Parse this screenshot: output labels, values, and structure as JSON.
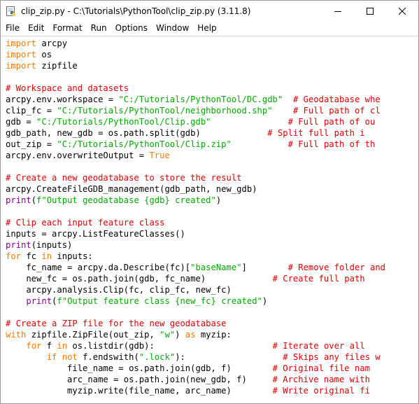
{
  "window": {
    "title": "clip_zip.py - C:\\Tutorials\\PythonTool\\clip_zip.py (3.11.8)",
    "icons": {
      "app": "python-idle-icon",
      "minimize": "minimize-icon",
      "maximize": "maximize-icon",
      "close": "close-icon"
    }
  },
  "menu": [
    "File",
    "Edit",
    "Format",
    "Run",
    "Options",
    "Window",
    "Help"
  ],
  "colors": {
    "keyword": "#ff7700",
    "string": "#00aa00",
    "comment": "#dd0000",
    "builtin": "#900090",
    "default": "#000000"
  },
  "code_lines": [
    [
      [
        "kw",
        "import"
      ],
      [
        "t",
        " arcpy"
      ]
    ],
    [
      [
        "kw",
        "import"
      ],
      [
        "t",
        " os"
      ]
    ],
    [
      [
        "kw",
        "import"
      ],
      [
        "t",
        " zipfile"
      ]
    ],
    [],
    [
      [
        "com",
        "# Workspace and datasets"
      ]
    ],
    [
      [
        "t",
        "arcpy.env.workspace = "
      ],
      [
        "str",
        "\"C:/Tutorials/PythonTool/DC.gdb\""
      ],
      [
        "t",
        "  "
      ],
      [
        "com",
        "# Geodatabase whe"
      ]
    ],
    [
      [
        "t",
        "clip_fc = "
      ],
      [
        "str",
        "\"C:/Tutorials/PythonTool/neighborhood.shp\""
      ],
      [
        "t",
        "    "
      ],
      [
        "com",
        "# Full path of cl"
      ]
    ],
    [
      [
        "t",
        "gdb = "
      ],
      [
        "str",
        "\"C:/Tutorials/PythonTool/Clip.gdb\""
      ],
      [
        "t",
        "               "
      ],
      [
        "com",
        "# Full path of ou"
      ]
    ],
    [
      [
        "t",
        "gdb_path, new_gdb = os.path.split(gdb)"
      ],
      [
        "t",
        "             "
      ],
      [
        "com",
        "# Split full path i"
      ]
    ],
    [
      [
        "t",
        "out_zip = "
      ],
      [
        "str",
        "\"C:/Tutorials/PythonTool/Clip.zip\""
      ],
      [
        "t",
        "           "
      ],
      [
        "com",
        "# Full path of th"
      ]
    ],
    [
      [
        "t",
        "arcpy.env.overwriteOutput = "
      ],
      [
        "kw",
        "True"
      ]
    ],
    [],
    [
      [
        "com",
        "# Create a new geodatabase to store the result"
      ]
    ],
    [
      [
        "t",
        "arcpy.CreateFileGDB_management(gdb_path, new_gdb)"
      ]
    ],
    [
      [
        "bi",
        "print"
      ],
      [
        "t",
        "("
      ],
      [
        "str",
        "f\"Output geodatabase {gdb} created\""
      ],
      [
        "t",
        ")"
      ]
    ],
    [],
    [
      [
        "com",
        "# Clip each input feature class"
      ]
    ],
    [
      [
        "t",
        "inputs = arcpy.ListFeatureClasses()"
      ]
    ],
    [
      [
        "bi",
        "print"
      ],
      [
        "t",
        "(inputs)"
      ]
    ],
    [
      [
        "kw",
        "for"
      ],
      [
        "t",
        " fc "
      ],
      [
        "kw",
        "in"
      ],
      [
        "t",
        " inputs:"
      ]
    ],
    [
      [
        "t",
        "    fc_name = arcpy.da.Describe(fc)["
      ],
      [
        "str",
        "\"baseName\""
      ],
      [
        "t",
        "]"
      ],
      [
        "t",
        "        "
      ],
      [
        "com",
        "# Remove folder and"
      ]
    ],
    [
      [
        "t",
        "    new_fc = os.path.join(gdb, fc_name)"
      ],
      [
        "t",
        "             "
      ],
      [
        "com",
        "# Create full path "
      ]
    ],
    [
      [
        "t",
        "    arcpy.analysis.Clip(fc, clip_fc, new_fc)"
      ]
    ],
    [
      [
        "t",
        "    "
      ],
      [
        "bi",
        "print"
      ],
      [
        "t",
        "("
      ],
      [
        "str",
        "f\"Output feature class {new_fc} created\""
      ],
      [
        "t",
        ")"
      ]
    ],
    [],
    [
      [
        "com",
        "# Create a ZIP file for the new geodatabase"
      ]
    ],
    [
      [
        "kw",
        "with"
      ],
      [
        "t",
        " zipfile.ZipFile(out_zip, "
      ],
      [
        "str",
        "\"w\""
      ],
      [
        "t",
        ") "
      ],
      [
        "kw",
        "as"
      ],
      [
        "t",
        " myzip:"
      ]
    ],
    [
      [
        "t",
        "    "
      ],
      [
        "kw",
        "for"
      ],
      [
        "t",
        " f "
      ],
      [
        "kw",
        "in"
      ],
      [
        "t",
        " os.listdir(gdb):"
      ],
      [
        "t",
        "                       "
      ],
      [
        "com",
        "# Iterate over all "
      ]
    ],
    [
      [
        "t",
        "        "
      ],
      [
        "kw",
        "if"
      ],
      [
        "t",
        " "
      ],
      [
        "kw",
        "not"
      ],
      [
        "t",
        " f.endswith("
      ],
      [
        "str",
        "\".lock\""
      ],
      [
        "t",
        "):"
      ],
      [
        "t",
        "                   "
      ],
      [
        "com",
        "# Skips any files w"
      ]
    ],
    [
      [
        "t",
        "            file_name = os.path.join(gdb, f)"
      ],
      [
        "t",
        "        "
      ],
      [
        "com",
        "# Original file nam"
      ]
    ],
    [
      [
        "t",
        "            arc_name = os.path.join(new_gdb, f)"
      ],
      [
        "t",
        "     "
      ],
      [
        "com",
        "# Archive name with"
      ]
    ],
    [
      [
        "t",
        "            myzip.write(file_name, arc_name)"
      ],
      [
        "t",
        "        "
      ],
      [
        "com",
        "# Write original fi"
      ]
    ]
  ]
}
